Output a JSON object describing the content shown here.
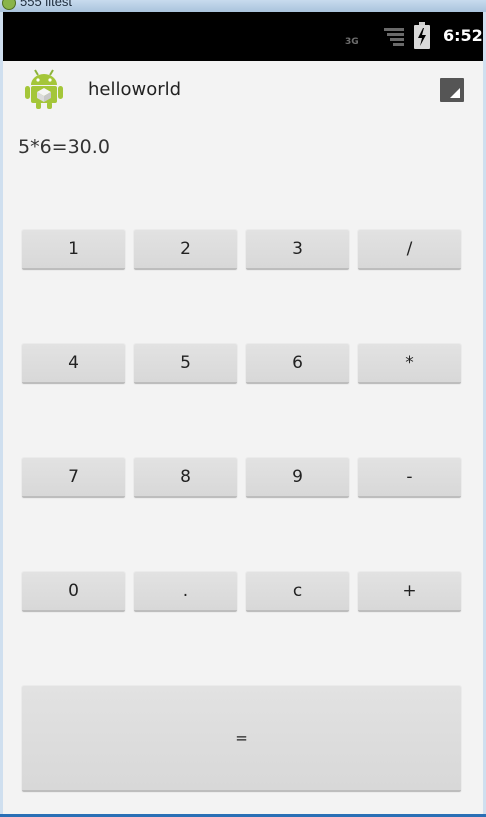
{
  "window": {
    "title": "555 litest"
  },
  "status_bar": {
    "network": "3G",
    "time": "6:52",
    "icons": [
      "signal-icon",
      "battery-charging-icon"
    ]
  },
  "action_bar": {
    "app_title": "helloworld",
    "app_icon": "android-robot-icon",
    "overflow_icon": "overflow-menu-icon"
  },
  "display": {
    "text": "5*6=30.0"
  },
  "keypad": {
    "rows": [
      [
        "1",
        "2",
        "3",
        "/"
      ],
      [
        "4",
        "5",
        "6",
        "*"
      ],
      [
        "7",
        "8",
        "9",
        "-"
      ],
      [
        "0",
        ".",
        "c",
        "+"
      ]
    ],
    "equals": "="
  },
  "colors": {
    "background": "#f3f3f3",
    "status_bar": "#000000",
    "key": "#dcdcdc",
    "android_green": "#a4c639"
  }
}
